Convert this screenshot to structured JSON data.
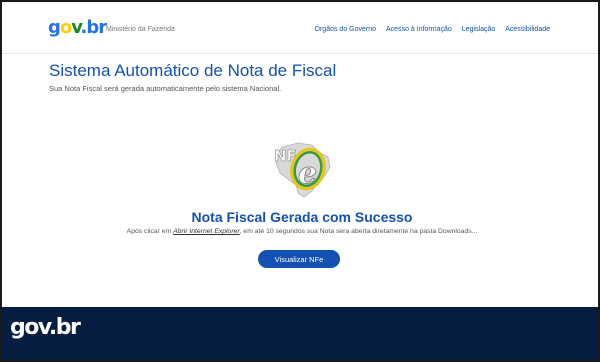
{
  "header": {
    "logo": {
      "g": "g",
      "o": "o",
      "v": "v",
      "dot": ".",
      "b": "b",
      "r": "r"
    },
    "ministry": "Ministério da Fazenda",
    "nav": [
      "Órgãos do Governo",
      "Acesso à Informação",
      "Legislação",
      "Acessibilidade"
    ]
  },
  "main": {
    "title": "Sistema Automático de Nota de Fiscal",
    "subtitle": "Sua Nota Fiscal será gerada automaticamente pelo sistema Nacional.",
    "logo_text": "NFe",
    "success_title": "Nota Fiscal Gerada com Sucesso",
    "desc_before": "Após clicar em ",
    "desc_link": "Abrir Internet Explorer",
    "desc_after": ", em até 10 segundos sua Nota sera aberta diretamente na pasta Downloads...",
    "button_label": "Visualizar NFe"
  },
  "footer": {
    "logo": "gov.br"
  },
  "colors": {
    "primary": "#1351b4",
    "footer_bg": "#071d41",
    "nfe_green": "#3a9a3a",
    "nfe_yellow": "#e8c514"
  }
}
